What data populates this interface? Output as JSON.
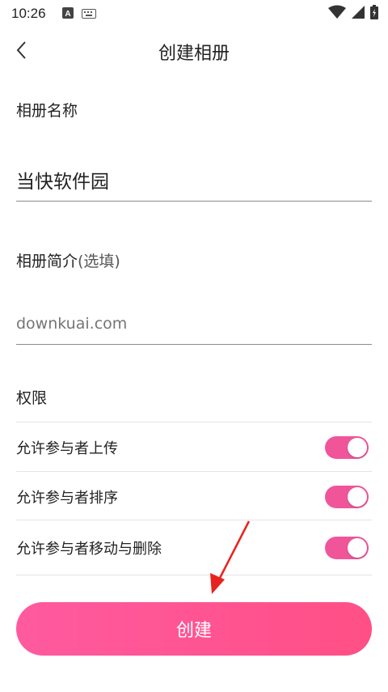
{
  "status_bar": {
    "time": "10:26",
    "icons": [
      "a-letter-icon",
      "keyboard-icon",
      "wifi-icon",
      "signal-icon",
      "battery-icon"
    ]
  },
  "nav": {
    "title": "创建相册",
    "back_icon": "chevron-left-icon"
  },
  "form": {
    "name_label": "相册名称",
    "name_value": "当快软件园",
    "desc_label": "相册简介",
    "desc_optional": "(选填)",
    "desc_placeholder": "downkuai.com",
    "permissions_label": "权限"
  },
  "permissions": [
    {
      "label": "允许参与者上传",
      "enabled": true
    },
    {
      "label": "允许参与者排序",
      "enabled": true
    },
    {
      "label": "允许参与者移动与删除",
      "enabled": true
    }
  ],
  "create_button": {
    "label": "创建"
  },
  "colors": {
    "accent": "#f0559a",
    "button_gradient_start": "#ff5a9f",
    "button_gradient_end": "#ff4f86",
    "annotation_arrow": "#e8231f"
  }
}
